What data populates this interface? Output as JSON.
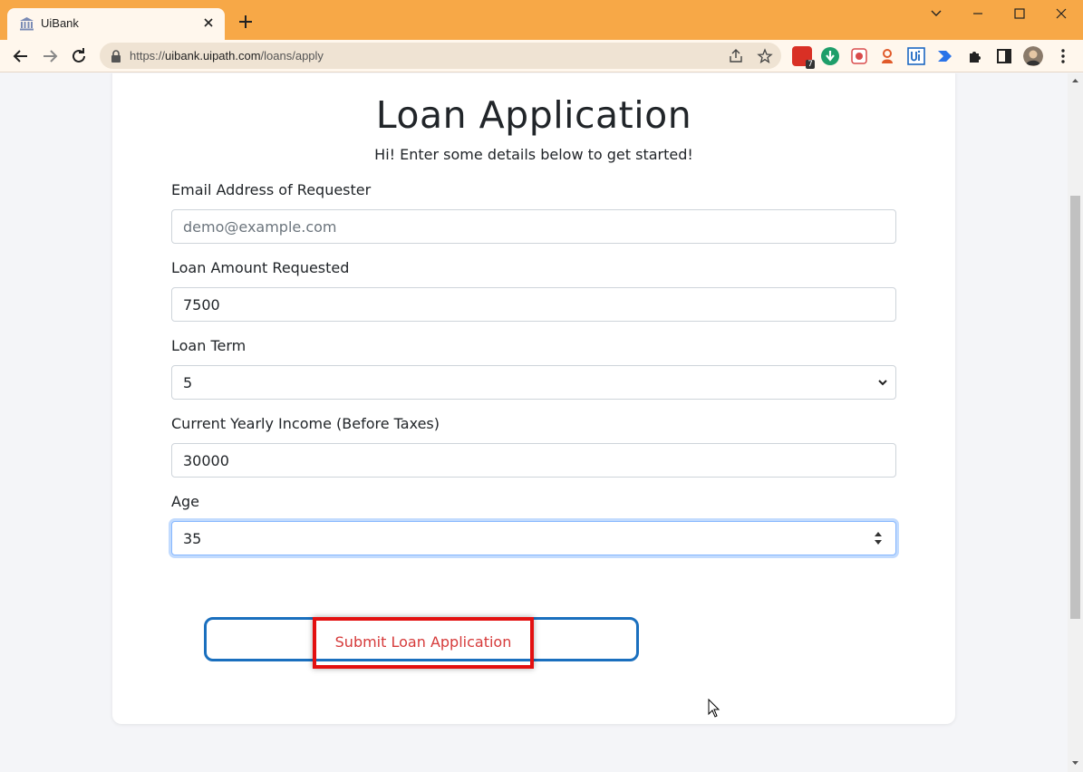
{
  "browser": {
    "tab_title": "UiBank",
    "url_prefix": "https://",
    "url_host": "uibank.uipath.com",
    "url_path": "/loans/apply",
    "extension_badge": "7"
  },
  "form": {
    "title": "Loan Application",
    "subtitle": "Hi! Enter some details below to get started!",
    "email_label": "Email Address of Requester",
    "email_placeholder": "demo@example.com",
    "amount_label": "Loan Amount Requested",
    "amount_value": "7500",
    "term_label": "Loan Term",
    "term_value": "5",
    "income_label": "Current Yearly Income (Before Taxes)",
    "income_value": "30000",
    "age_label": "Age",
    "age_value": "35",
    "submit_label": "Submit Loan Application"
  },
  "colors": {
    "titlebar": "#f7a847",
    "submit_border": "#1a6fbe",
    "highlight_box": "#e31010",
    "submit_text": "#d63a3a"
  }
}
